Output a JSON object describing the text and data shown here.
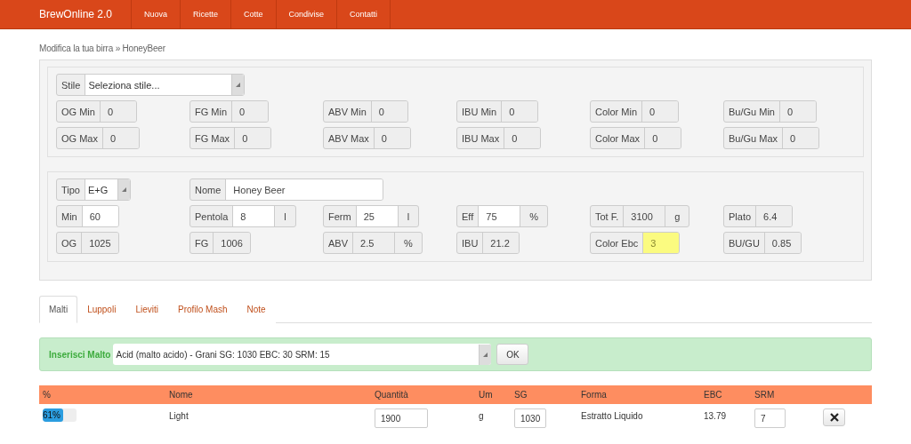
{
  "navbar": {
    "brand": "BrewOnline 2.0",
    "items": [
      {
        "label": "Nuova",
        "selected": false
      },
      {
        "label": "Ricette",
        "selected": false
      },
      {
        "label": "Cotte",
        "selected": false
      },
      {
        "label": "Condivise",
        "selected": false
      },
      {
        "label": "Contatti",
        "selected": false
      }
    ]
  },
  "breadcrumb": "Modifica la tua birra » HoneyBeer",
  "style_panel": {
    "style_select": {
      "label": "Stile",
      "value": "Seleziona stile..."
    },
    "fields": [
      {
        "label": "OG Min",
        "value": "0"
      },
      {
        "label": "FG Min",
        "value": "0"
      },
      {
        "label": "ABV Min",
        "value": "0"
      },
      {
        "label": "IBU Min",
        "value": "0"
      },
      {
        "label": "Color Min",
        "value": "0"
      },
      {
        "label": "Bu/Gu Min",
        "value": "0"
      },
      {
        "label": "OG Max",
        "value": "0"
      },
      {
        "label": "FG Max",
        "value": "0"
      },
      {
        "label": "ABV Max",
        "value": "0"
      },
      {
        "label": "IBU Max",
        "value": "0"
      },
      {
        "label": "Color Max",
        "value": "0"
      },
      {
        "label": "Bu/Gu Max",
        "value": "0"
      }
    ]
  },
  "recipe_panel": {
    "type_select": {
      "label": "Tipo",
      "value": "E+G"
    },
    "name_field": {
      "label": "Nome",
      "value": "Honey Beer"
    },
    "fields": [
      {
        "label": "Min",
        "value": "60",
        "readonly": false
      },
      {
        "label": "Pentola",
        "value": "8",
        "unit": "l",
        "readonly": false
      },
      {
        "label": "Ferm",
        "value": "25",
        "unit": "l",
        "readonly": false
      },
      {
        "label": "Eff",
        "value": "75",
        "unit": "%",
        "readonly": false
      },
      {
        "label": "Tot F.",
        "value": "3100",
        "unit": "g",
        "readonly": true
      },
      {
        "label": "Plato",
        "value": "6.4",
        "readonly": true
      },
      {
        "label": "OG",
        "value": "1025",
        "readonly": true
      },
      {
        "label": "FG",
        "value": "1006",
        "readonly": true
      },
      {
        "label": "ABV",
        "value": "2.5",
        "unit": "%",
        "readonly": true
      },
      {
        "label": "IBU",
        "value": "21.2",
        "readonly": true
      },
      {
        "label": "Color Ebc",
        "value": "3",
        "color": "#fbfb80"
      },
      {
        "label": "BU/GU",
        "value": "0.85",
        "readonly": true
      }
    ]
  },
  "tabs": [
    {
      "label": "Malti",
      "selected": true
    },
    {
      "label": "Luppoli",
      "selected": false
    },
    {
      "label": "Lieviti",
      "selected": false
    },
    {
      "label": "Profilo Mash",
      "selected": false
    },
    {
      "label": "Note",
      "selected": false
    }
  ],
  "malt_insert": {
    "label": "Inserisci Malto",
    "value": "Acid (malto acido) - Grani SG: 1030 EBC: 30 SRM: 15",
    "button": "OK"
  },
  "table": {
    "columns": [
      "%",
      "Nome",
      "Quantità",
      "Um",
      "SG",
      "Forma",
      "EBC",
      "SRM"
    ],
    "rows": [
      {
        "percent": "61%",
        "level": 0.61,
        "name": "Light",
        "quantity": "1900",
        "unit": "g",
        "sg": "1030",
        "form": "Estratto Liquido",
        "ebc": "13.79",
        "srm": "7"
      }
    ]
  }
}
